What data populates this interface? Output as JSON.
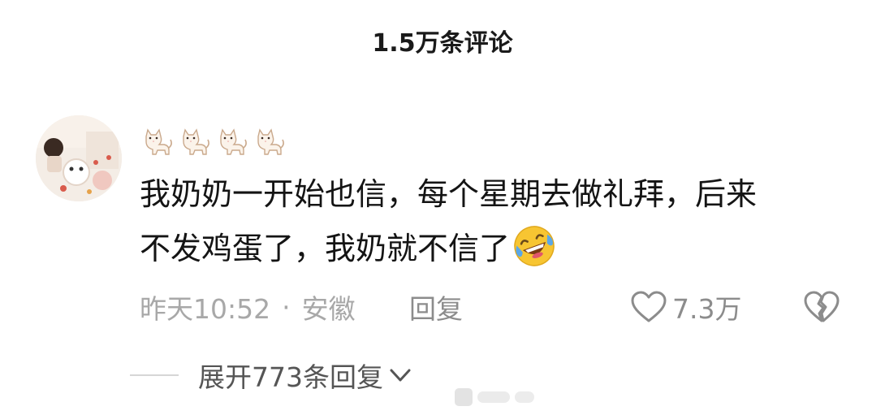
{
  "header": {
    "title": "1.5万条评论"
  },
  "comment": {
    "username_icons": [
      "cat-icon",
      "cat-icon",
      "cat-icon",
      "cat-icon"
    ],
    "text_line1": "我奶奶一开始也信，每个星期去做礼拜，后来",
    "text_line2": "不发鸡蛋了，我奶就不信了",
    "emoji": "rolling-on-floor-laughing-emoji",
    "time": "昨天10:52",
    "separator": "·",
    "location": "安徽",
    "reply_label": "回复",
    "like_count": "7.3万",
    "expand_label": "展开773条回复"
  },
  "colors": {
    "text_primary": "#141414",
    "text_secondary": "#a8a8a8",
    "text_action": "#8c8c8c",
    "emoji_yellow": "#f7c532",
    "tear_blue": "#5aa7e8"
  }
}
